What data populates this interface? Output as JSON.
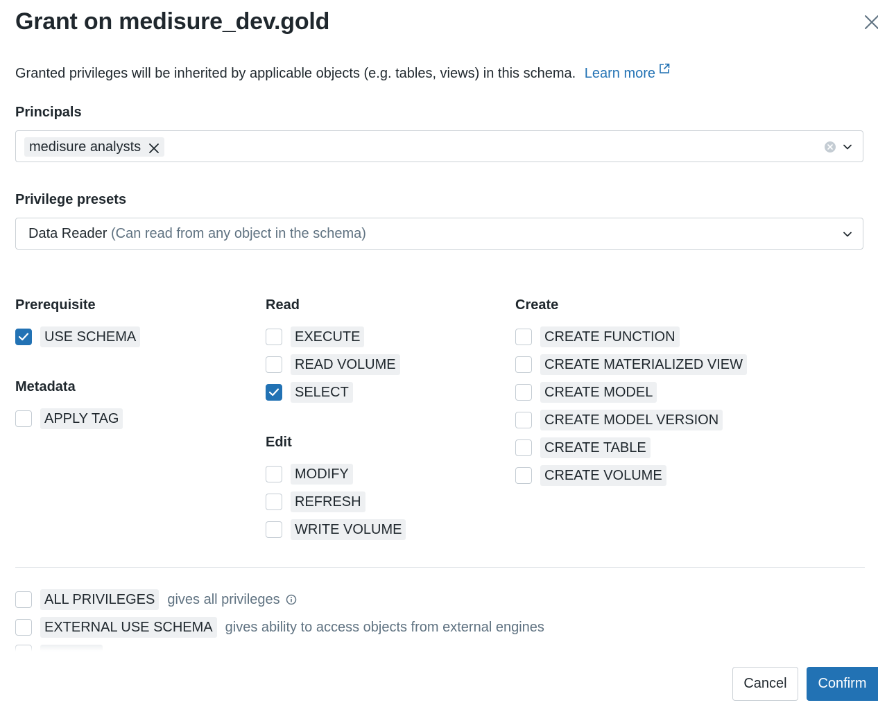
{
  "dialog": {
    "title": "Grant on medisure_dev.gold",
    "description": "Granted privileges will be inherited by applicable objects (e.g. tables, views) in this schema.",
    "learn_more": "Learn more"
  },
  "principals": {
    "label": "Principals",
    "selected": [
      "medisure analysts"
    ]
  },
  "presets": {
    "label": "Privilege presets",
    "value": "Data Reader",
    "hint": "(Can read from any object in the schema)"
  },
  "groups": {
    "prerequisite": {
      "heading": "Prerequisite",
      "items": [
        {
          "label": "USE SCHEMA",
          "checked": true
        }
      ]
    },
    "metadata": {
      "heading": "Metadata",
      "items": [
        {
          "label": "APPLY TAG",
          "checked": false
        }
      ]
    },
    "read": {
      "heading": "Read",
      "items": [
        {
          "label": "EXECUTE",
          "checked": false
        },
        {
          "label": "READ VOLUME",
          "checked": false
        },
        {
          "label": "SELECT",
          "checked": true
        }
      ]
    },
    "edit": {
      "heading": "Edit",
      "items": [
        {
          "label": "MODIFY",
          "checked": false
        },
        {
          "label": "REFRESH",
          "checked": false
        },
        {
          "label": "WRITE VOLUME",
          "checked": false
        }
      ]
    },
    "create": {
      "heading": "Create",
      "items": [
        {
          "label": "CREATE FUNCTION",
          "checked": false
        },
        {
          "label": "CREATE MATERIALIZED VIEW",
          "checked": false
        },
        {
          "label": "CREATE MODEL",
          "checked": false
        },
        {
          "label": "CREATE MODEL VERSION",
          "checked": false
        },
        {
          "label": "CREATE TABLE",
          "checked": false
        },
        {
          "label": "CREATE VOLUME",
          "checked": false
        }
      ]
    }
  },
  "extras": [
    {
      "label": "ALL PRIVILEGES",
      "hint": "gives all privileges",
      "checked": false,
      "info": true
    },
    {
      "label": "EXTERNAL USE SCHEMA",
      "hint": "gives ability to access objects from external engines",
      "checked": false
    }
  ],
  "footer": {
    "cancel": "Cancel",
    "confirm": "Confirm"
  },
  "colors": {
    "accent": "#2272b4",
    "tag_bg": "#eef0f2",
    "hint": "#5f7281"
  },
  "icons": {
    "close": "close-icon",
    "external_link": "external-link-icon",
    "clear": "clear-circle-icon",
    "dropdown": "chevron-down-icon",
    "info": "info-icon",
    "check": "checkmark-icon"
  }
}
